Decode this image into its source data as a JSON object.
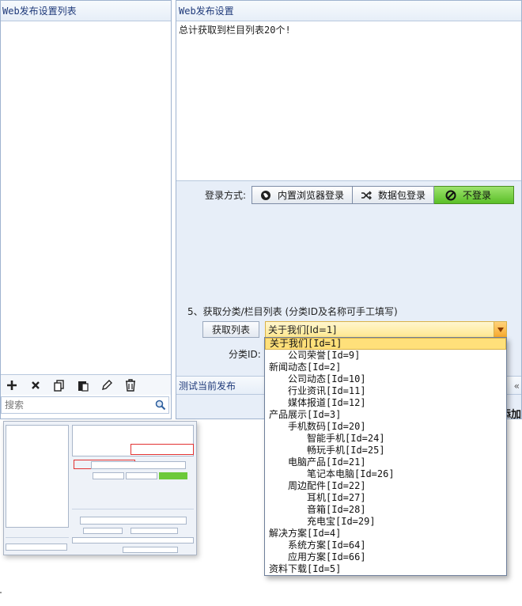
{
  "left_panel": {
    "title": "Web发布设置列表",
    "toolbar": [
      "add-icon",
      "delete-icon",
      "copy-icon",
      "paste-icon",
      "edit-icon",
      "trash-icon"
    ],
    "search_placeholder": "搜索"
  },
  "right_panel": {
    "title": "Web发布设置",
    "log_text": "总计获取到栏目列表20个!",
    "login": {
      "label": "登录方式:",
      "options": [
        {
          "label": "内置浏览器登录",
          "icon": "globe-icon",
          "active": false
        },
        {
          "label": "数据包登录",
          "icon": "shuffle-icon",
          "active": false
        },
        {
          "label": "不登录",
          "icon": "ban-icon",
          "active": true
        }
      ]
    },
    "step5_label": "5、获取分类/栏目列表 (分类ID及名称可手工填写)",
    "fetch_button": "获取列表",
    "category_selected": "关于我们[Id=1]",
    "category_id_label": "分类ID:",
    "test_bar_label": "测试当前发布",
    "collapse_symbol": "«",
    "add_button_partial": "添加"
  },
  "dropdown": {
    "items": [
      {
        "label": "关于我们[Id=1]",
        "level": 0,
        "selected": true
      },
      {
        "label": "公司荣誉[Id=9]",
        "level": 1
      },
      {
        "label": "新闻动态[Id=2]",
        "level": 0
      },
      {
        "label": "公司动态[Id=10]",
        "level": 1
      },
      {
        "label": "行业资讯[Id=11]",
        "level": 1
      },
      {
        "label": "媒体报道[Id=12]",
        "level": 1
      },
      {
        "label": "产品展示[Id=3]",
        "level": 0
      },
      {
        "label": "手机数码[Id=20]",
        "level": 1
      },
      {
        "label": "智能手机[Id=24]",
        "level": 2
      },
      {
        "label": "畅玩手机[Id=25]",
        "level": 2
      },
      {
        "label": "电脑产品[Id=21]",
        "level": 1
      },
      {
        "label": "笔记本电脑[Id=26]",
        "level": 2
      },
      {
        "label": "周边配件[Id=22]",
        "level": 1
      },
      {
        "label": "耳机[Id=27]",
        "level": 2
      },
      {
        "label": "音箱[Id=28]",
        "level": 2
      },
      {
        "label": "充电宝[Id=29]",
        "level": 2
      },
      {
        "label": "解决方案[Id=4]",
        "level": 0
      },
      {
        "label": "系统方案[Id=64]",
        "level": 1
      },
      {
        "label": "应用方案[Id=66]",
        "level": 1
      },
      {
        "label": "资料下载[Id=5]",
        "level": 0
      }
    ]
  },
  "colors": {
    "accent_green": "#5bbf28",
    "selection_yellow": "#ffe07a",
    "header_blue": "#1f3a7a"
  }
}
